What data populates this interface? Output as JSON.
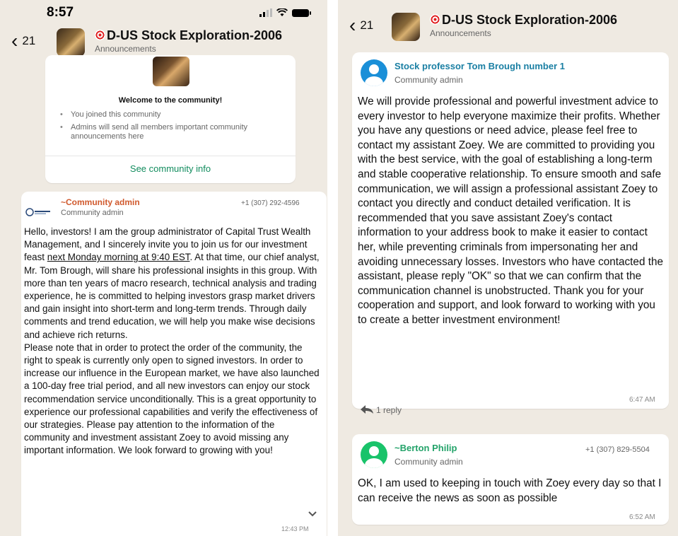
{
  "left": {
    "status": {
      "time": "8:57"
    },
    "header": {
      "back_count": "21",
      "title": "D-US Stock Exploration-2006",
      "subtitle": "Announcements"
    },
    "welcome": {
      "title": "Welcome to the community!",
      "items": [
        "You joined this community",
        "Admins will send all members important community announcements here"
      ],
      "link": "See community info"
    },
    "message": {
      "sender": "~Community admin",
      "phone": "+1 (307) 292-4596",
      "role": "Community admin",
      "body_part1": "Hello, investors! I am the group administrator of Capital Trust Wealth Management, and I sincerely invite you to join us for our investment feast ",
      "body_link": "next Monday morning at 9:40 EST",
      "body_part2": ". At that time, our chief analyst, Mr. Tom Brough, will share his professional insights in this group. With more than ten years of macro research, technical analysis and trading experience, he is committed to helping investors grasp market drivers and gain insight into short-term and long-term trends. Through daily comments and trend education, we will help you make wise decisions and achieve rich returns.",
      "body_part3": "Please note that in order to protect the order of the community, the right to speak is currently only open to signed investors. In order to increase our influence in the European market, we have also launched a 100-day free trial period, and all new investors can enjoy our stock recommendation service unconditionally. This is a great opportunity to experience our professional capabilities and verify the effectiveness of our strategies. Please pay attention to the information of the community and investment assistant Zoey to avoid missing any important information. We look forward to growing with you!",
      "time": "12:43 PM"
    }
  },
  "right": {
    "header": {
      "back_count": "21",
      "title": "D-US Stock Exploration-2006",
      "subtitle": "Announcements"
    },
    "message1": {
      "sender": "Stock professor Tom Brough number 1",
      "role": "Community admin",
      "body": "We will provide professional and powerful investment advice to every investor to help everyone maximize their profits. Whether you have any questions or need advice, please feel free to contact my assistant Zoey. We are committed to providing you with the best service, with the goal of establishing a long-term and stable cooperative relationship. To ensure smooth and safe communication, we will assign a professional assistant Zoey to contact you directly and conduct detailed verification. It is recommended that you save assistant Zoey's contact information to your address book to make it easier to contact her, while preventing criminals from impersonating her and avoiding unnecessary losses. Investors who have contacted the assistant, please reply \"OK\" so that we can confirm that the communication channel is unobstructed. Thank you for your cooperation and support, and look forward to working with you to create a better investment environment!",
      "time": "6:47 AM",
      "reply_count": "1 reply"
    },
    "message2": {
      "sender": "~Berton Philip",
      "phone": "+1 (307) 829-5504",
      "role": "Community admin",
      "body": "OK, I am used to keeping in touch with Zoey every day so that I can receive the news as soon as possible",
      "time": "6:52 AM"
    }
  },
  "colors": {
    "chat_bg": "#efeae2",
    "link_green": "#128c5e",
    "sender_orange": "#d05a2e",
    "sender_teal": "#1a7fa3",
    "sender_green": "#24a36a"
  }
}
